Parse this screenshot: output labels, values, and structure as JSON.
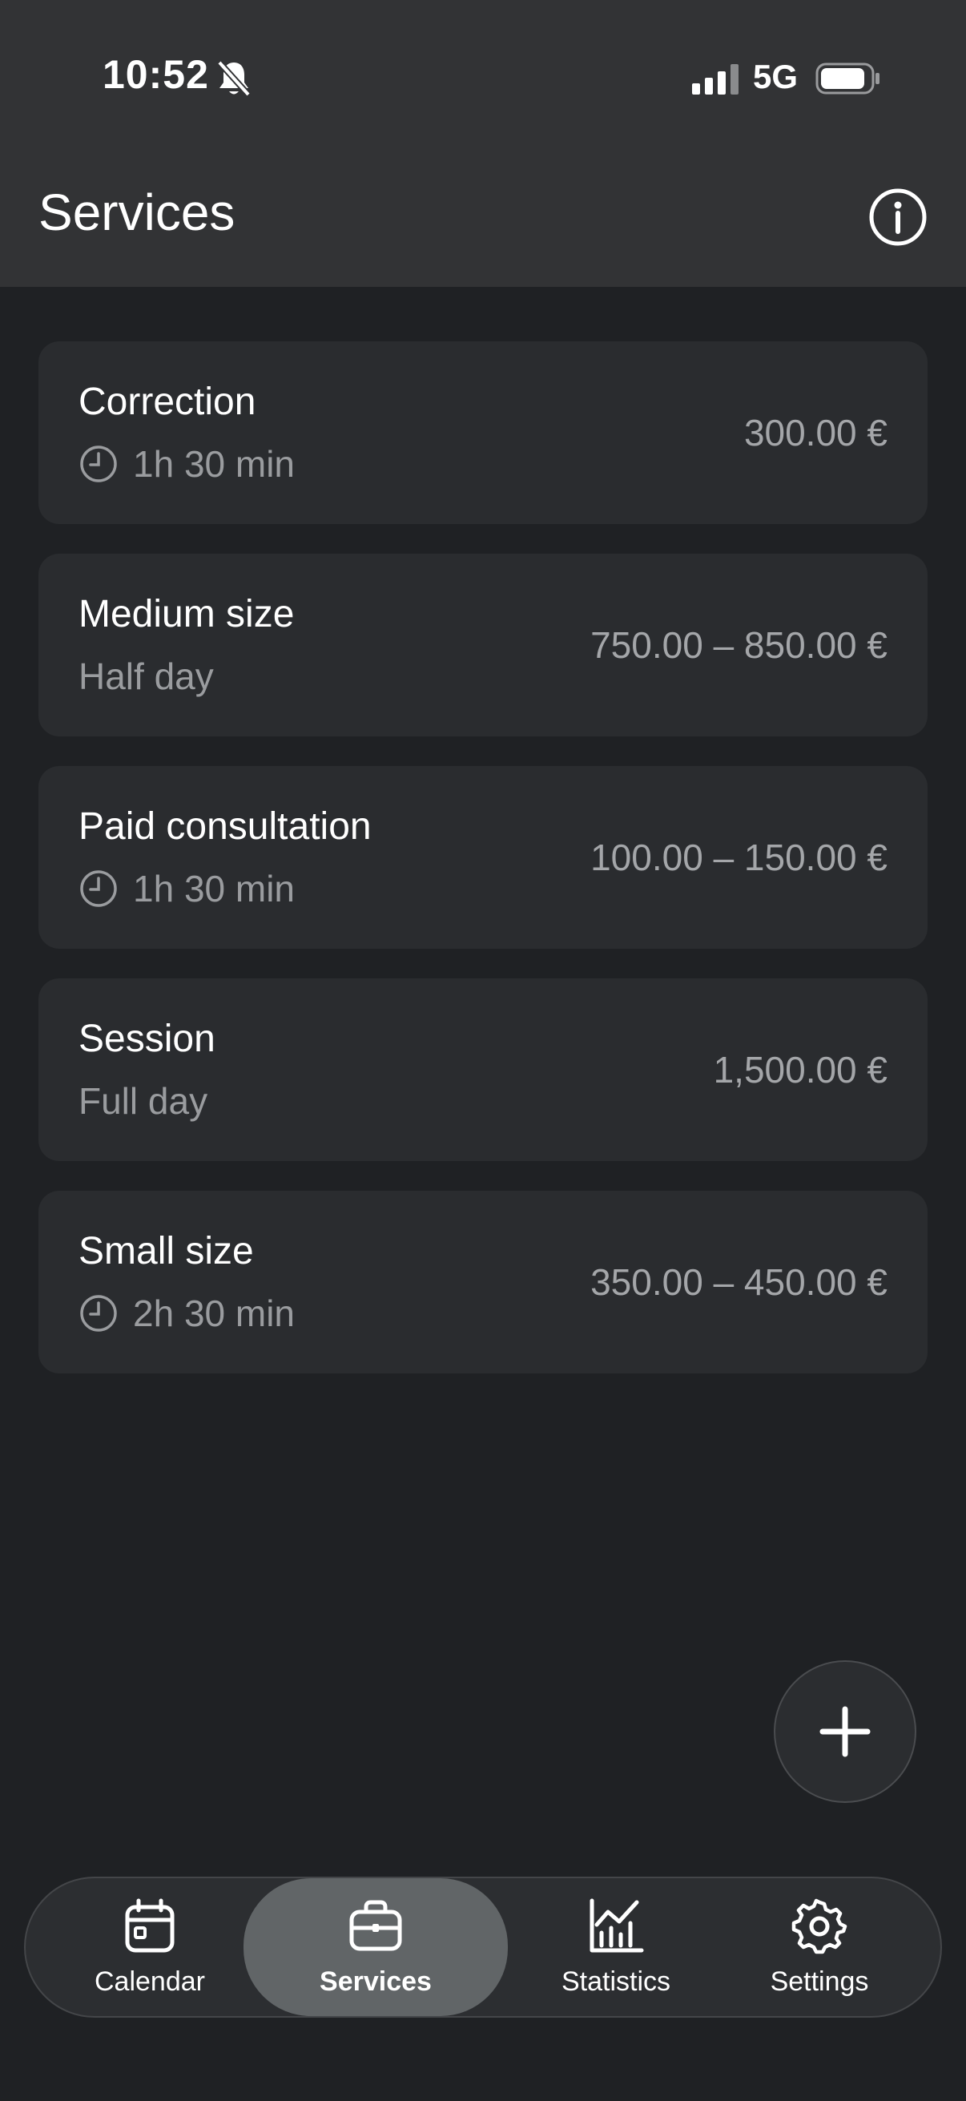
{
  "status_bar": {
    "time": "10:52",
    "network": "5G"
  },
  "header": {
    "title": "Services"
  },
  "services": [
    {
      "name": "Correction",
      "duration": "1h 30 min",
      "has_clock": true,
      "price": "300.00 €"
    },
    {
      "name": "Medium size",
      "duration": "Half day",
      "has_clock": false,
      "price": "750.00 – 850.00 €"
    },
    {
      "name": "Paid consultation",
      "duration": "1h 30 min",
      "has_clock": true,
      "price": "100.00 – 150.00 €"
    },
    {
      "name": "Session",
      "duration": "Full day",
      "has_clock": false,
      "price": "1,500.00 €"
    },
    {
      "name": "Small size",
      "duration": "2h 30 min",
      "has_clock": true,
      "price": "350.00 – 450.00 €"
    }
  ],
  "tabs": [
    {
      "label": "Calendar",
      "icon": "calendar-icon"
    },
    {
      "label": "Services",
      "icon": "briefcase-icon",
      "active": true
    },
    {
      "label": "Statistics",
      "icon": "chart-icon"
    },
    {
      "label": "Settings",
      "icon": "gear-icon"
    }
  ],
  "colors": {
    "background": "#1f2124",
    "header": "#323335",
    "card": "#2a2c2f",
    "active_tab": "#616567"
  }
}
